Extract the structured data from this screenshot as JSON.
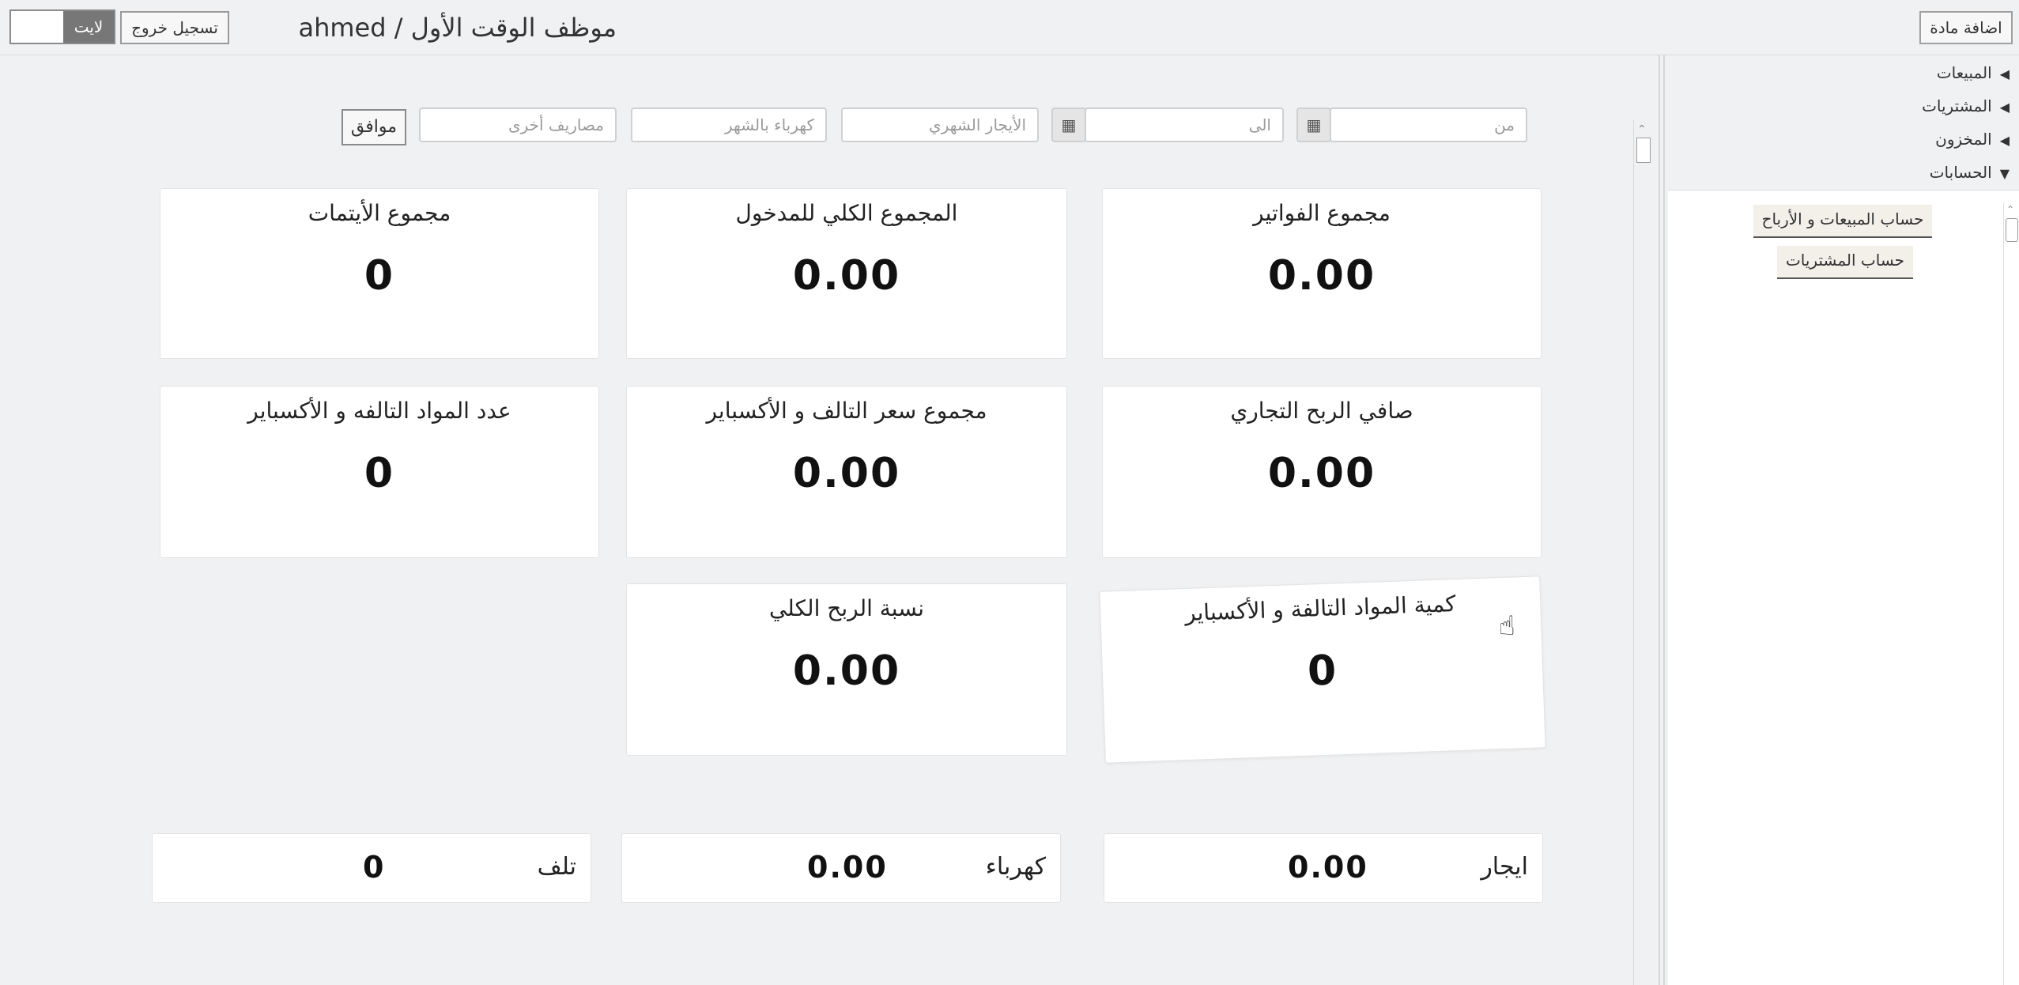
{
  "topbar": {
    "theme_label": "لايت",
    "logout_label": "تسجيل خروج",
    "page_title": "ahmed / موظف الوقت الأول",
    "add_item_label": "اضافة مادة"
  },
  "filters": {
    "from_placeholder": "من",
    "to_placeholder": "الى",
    "rent_placeholder": "الأيجار الشهري",
    "electricity_placeholder": "كهرباء بالشهر",
    "other_expenses_placeholder": "مصاريف أخرى",
    "ok_label": "موافق",
    "calendar_icon": "calendar-icon"
  },
  "cards": {
    "invoices_total": {
      "title": "مجموع الفواتير",
      "value": "0.00"
    },
    "income_total": {
      "title": "المجموع الكلي للمدخول",
      "value": "0.00"
    },
    "orphans_total": {
      "title": "مجموع الأيتمات",
      "value": "0"
    },
    "net_profit": {
      "title": "صافي الربح التجاري",
      "value": "0.00"
    },
    "damaged_price_total": {
      "title": "مجموع سعر التالف و الأكسباير",
      "value": "0.00"
    },
    "damaged_count": {
      "title": "عدد المواد التالفه و الأكسباير",
      "value": "0"
    },
    "damaged_quantity": {
      "title": "كمية المواد التالفة و الأكسباير",
      "value": "0"
    },
    "profit_ratio": {
      "title": "نسبة الربح الكلي",
      "value": "0.00"
    }
  },
  "summary": {
    "rent": {
      "label": "ايجار",
      "value": "0.00"
    },
    "electricity": {
      "label": "كهرباء",
      "value": "0.00"
    },
    "damage": {
      "label": "تلف",
      "value": "0"
    }
  },
  "sidebar": {
    "items": [
      {
        "label": "المبيعات",
        "expanded": false
      },
      {
        "label": "المشتريات",
        "expanded": false
      },
      {
        "label": "المخزون",
        "expanded": false
      },
      {
        "label": "الحسابات",
        "expanded": true
      }
    ],
    "collapsed_icon": "◀",
    "expanded_icon": "▼",
    "sub_items": [
      {
        "label": "حساب المبيعات و الأرباح"
      },
      {
        "label": "حساب المشتريات"
      }
    ]
  },
  "colors": {
    "background": "#f0f1f3",
    "card": "#ffffff",
    "toggle_knob": "#777777"
  }
}
